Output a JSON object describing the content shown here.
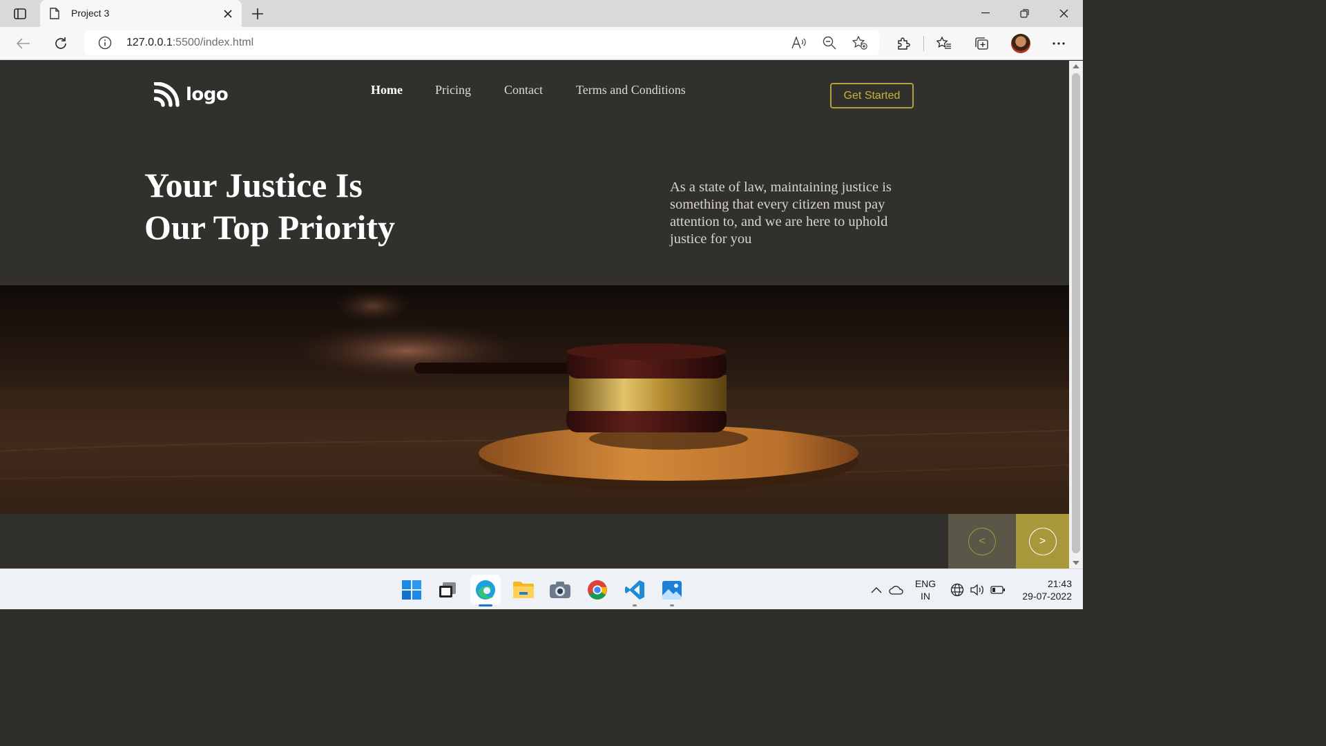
{
  "browser": {
    "tab_title": "Project 3",
    "url_host": "127.0.0.1",
    "url_rest": ":5500/index.html",
    "icons": [
      "sidebar-icon",
      "document-icon",
      "close-icon",
      "plus-icon",
      "minimize-icon",
      "restore-icon",
      "window-close-icon",
      "back-icon",
      "refresh-icon",
      "info-icon",
      "read-aloud-icon",
      "zoom-out-icon",
      "add-favorite-icon",
      "extensions-icon",
      "favorites-icon",
      "collections-icon",
      "profile-avatar",
      "more-icon"
    ]
  },
  "site": {
    "logo_text": "logo",
    "nav": [
      "Home",
      "Pricing",
      "Contact",
      "Terms and Conditions"
    ],
    "cta_label": "Get Started",
    "hero_title_line1": "Your Justice Is",
    "hero_title_line2": "Our Top Priority",
    "hero_description": "As a state of law, maintaining justice is something that every citizen must pay attention to, and we are here to uphold justice for you",
    "hero_image": "gavel-image",
    "prev_label": "<",
    "next_label": ">",
    "colors": {
      "background": "#31302c",
      "accent": "#b5a13a",
      "text": "#ffffff"
    }
  },
  "taskbar": {
    "apps": [
      "windows-start-icon",
      "task-view-icon",
      "edge-icon",
      "file-explorer-icon",
      "camera-icon",
      "chrome-icon",
      "vscode-icon",
      "photos-icon"
    ],
    "lang_line1": "ENG",
    "lang_line2": "IN",
    "time": "21:43",
    "date": "29-07-2022"
  }
}
